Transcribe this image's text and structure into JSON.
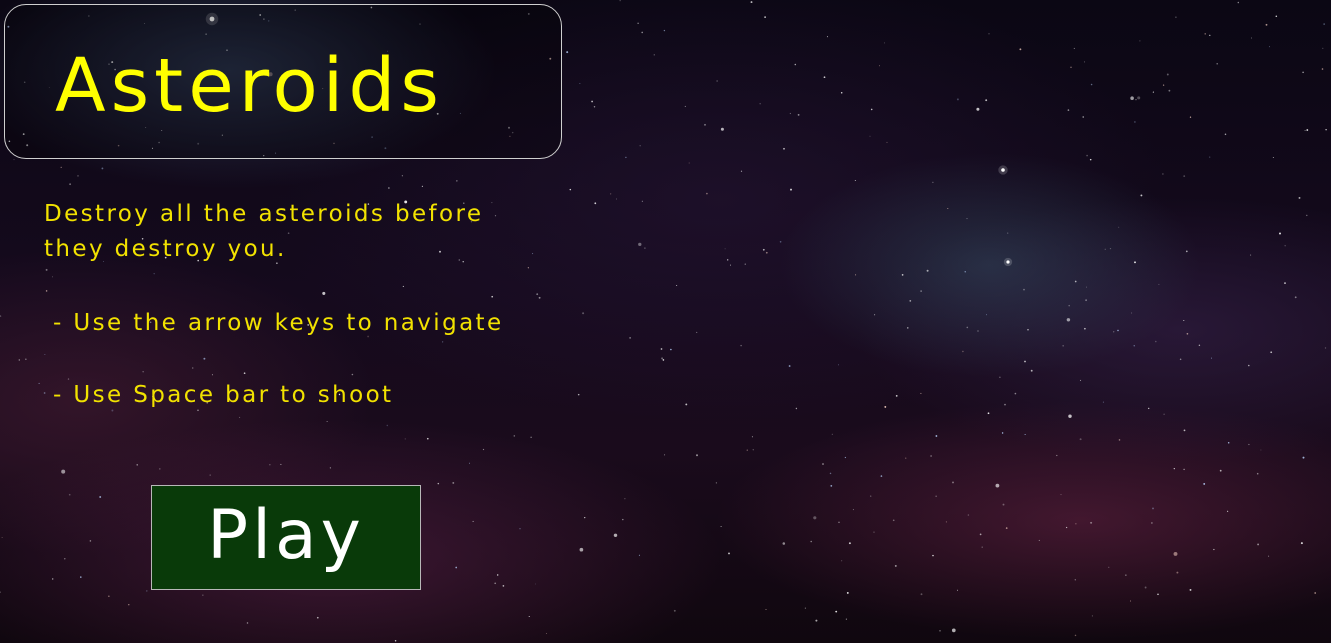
{
  "game": {
    "title": "Asteroids",
    "intro_line_1": "Destroy all the asteroids before",
    "intro_line_2": "they destroy you.",
    "instructions": [
      " - Use the arrow keys to navigate",
      " - Use Space bar to shoot"
    ],
    "play_label": "Play"
  },
  "colors": {
    "title_text": "#ffff00",
    "body_text": "#f2e200",
    "play_button_bg": "#093a09",
    "play_button_text": "#ffffff",
    "background": "#0b0714"
  }
}
